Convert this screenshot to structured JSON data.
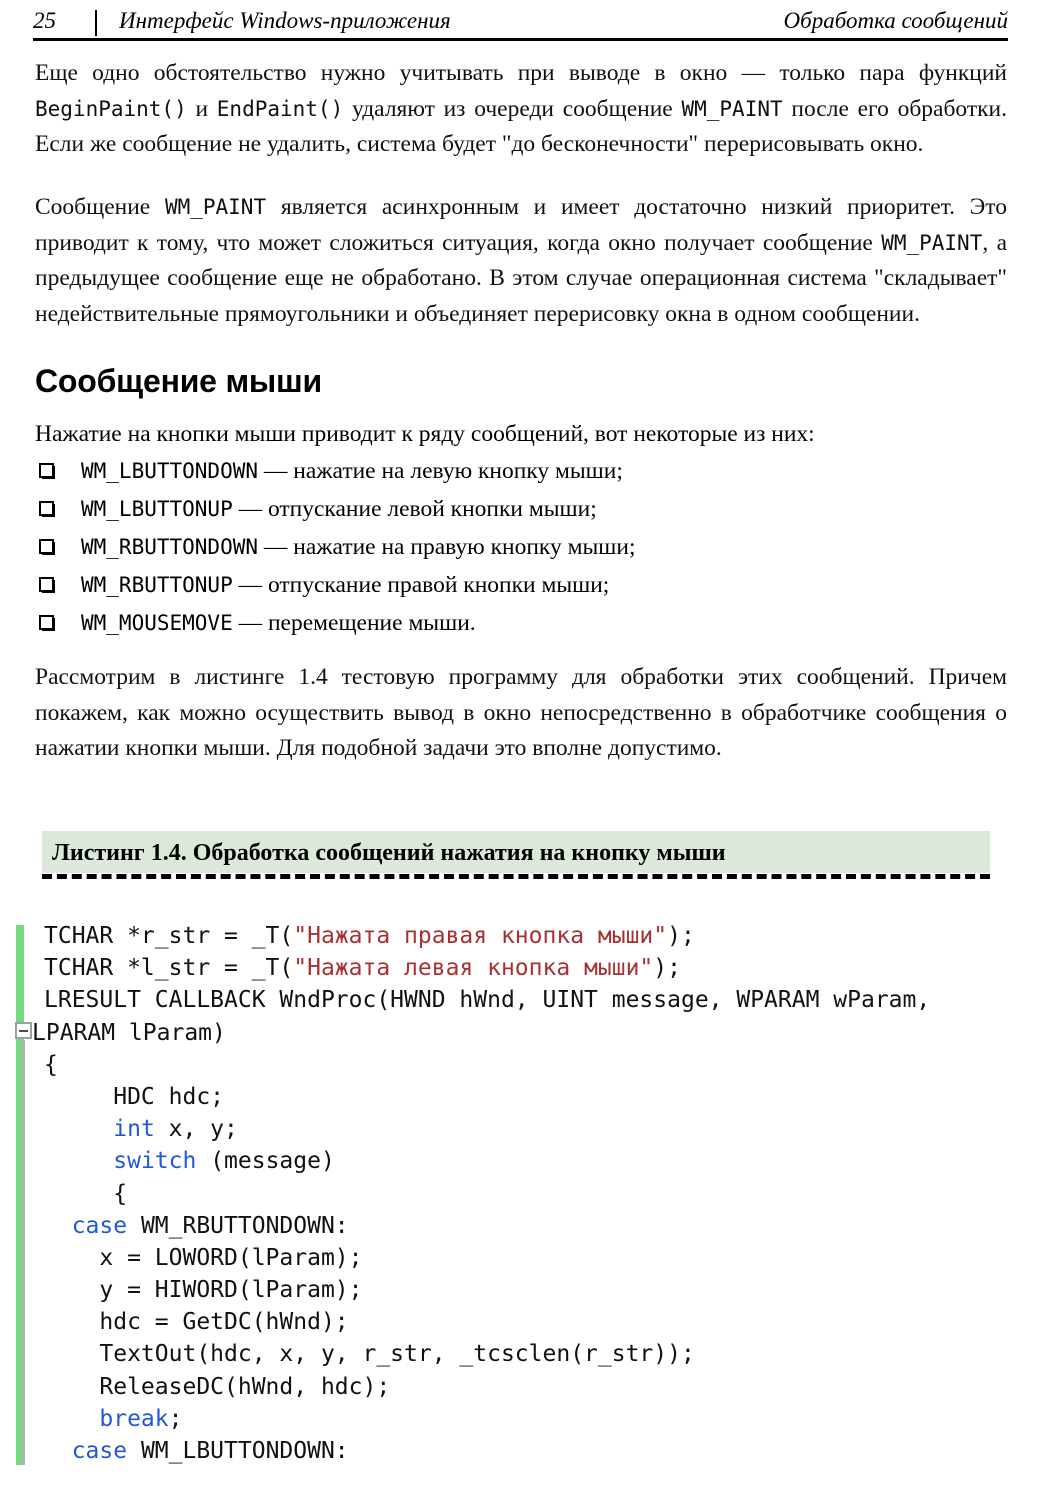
{
  "header": {
    "page_number": "25",
    "title_left": "Интерфейс Windows-приложения",
    "title_right": "Обработка сообщений"
  },
  "paragraphs": {
    "p1_a": "Еще одно обстоятельство нужно учитывать при выводе в окно — только пара функций ",
    "p1_code1": "BeginPaint()",
    "p1_b": " и ",
    "p1_code2": "EndPaint()",
    "p1_c": " удаляют из очереди сообщение ",
    "p1_code3": "WM_PAINT",
    "p1_d": " после его обработки. Если же сообщение не удалить, система будет \"до бесконечности\" перерисовывать окно.",
    "p2_a": "Сообщение ",
    "p2_code1": "WM_PAINT",
    "p2_b": " является асинхронным и имеет достаточно низкий приоритет. Это приводит к тому, что может сложиться ситуация, когда окно получает сообщение ",
    "p2_code2": "WM_PAINT",
    "p2_c": ", а предыдущее сообщение еще не обработано. В этом случае операционная система \"складывает\" недействительные прямоугольники и объединяет перерисовку окна в одном сообщении.",
    "p3": "Рассмотрим в листинге 1.4 тестовую программу для обработки этих сообщений. Причем покажем, как можно осуществить вывод в окно непосредственно в обработчике сообщения о нажатии кнопки мыши. Для подобной задачи это вполне допустимо."
  },
  "section": {
    "heading": "Сообщение мыши",
    "lead_in": "Нажатие на кнопки мыши приводит к ряду сообщений, вот некоторые из них:"
  },
  "message_list": [
    {
      "code": "WM_LBUTTONDOWN",
      "description": " — нажатие на левую кнопку мыши;"
    },
    {
      "code": "WM_LBUTTONUP",
      "description": " — отпускание левой кнопки мыши;"
    },
    {
      "code": "WM_RBUTTONDOWN",
      "description": " — нажатие на правую кнопку мыши;"
    },
    {
      "code": "WM_RBUTTONUP",
      "description": " — отпускание правой кнопки мыши;"
    },
    {
      "code": "WM_MOUSEMOVE",
      "description": " — перемещение мыши."
    }
  ],
  "listing": {
    "caption": "Листинг 1.4. Обработка сообщений нажатия на кнопку мыши",
    "band_color": "#dbe8da",
    "gutter_color": "#74da7f",
    "keyword_color": "#2457d6",
    "string_color": "#a83232",
    "collapse_marker": "−"
  },
  "code": {
    "lines": [
      {
        "segments": [
          {
            "t": "TCHAR *r_str = _T(",
            "c": "plain"
          },
          {
            "t": "\"Нажата правая кнопка мыши\"",
            "c": "str"
          },
          {
            "t": ");",
            "c": "plain"
          }
        ]
      },
      {
        "segments": [
          {
            "t": "TCHAR *l_str = _T(",
            "c": "plain"
          },
          {
            "t": "\"Нажата левая кнопка мыши\"",
            "c": "str"
          },
          {
            "t": ");",
            "c": "plain"
          }
        ]
      },
      {
        "segments": [
          {
            "t": "LRESULT CALLBACK WndProc(HWND hWnd, UINT message, WPARAM wParam,",
            "c": "plain"
          }
        ]
      },
      {
        "segments": [
          {
            "t": "LPARAM lParam)",
            "c": "plain"
          }
        ],
        "outdent": true
      },
      {
        "segments": [
          {
            "t": "{",
            "c": "plain"
          }
        ]
      },
      {
        "segments": [
          {
            "t": "     HDC hdc;",
            "c": "plain"
          }
        ]
      },
      {
        "segments": [
          {
            "t": "     ",
            "c": "plain"
          },
          {
            "t": "int",
            "c": "kw"
          },
          {
            "t": " x, y;",
            "c": "plain"
          }
        ]
      },
      {
        "segments": [
          {
            "t": "     ",
            "c": "plain"
          },
          {
            "t": "switch",
            "c": "kw"
          },
          {
            "t": " (message)",
            "c": "plain"
          }
        ]
      },
      {
        "segments": [
          {
            "t": "     {",
            "c": "plain"
          }
        ]
      },
      {
        "segments": [
          {
            "t": "  ",
            "c": "plain"
          },
          {
            "t": "case",
            "c": "kw"
          },
          {
            "t": " WM_RBUTTONDOWN:",
            "c": "plain"
          }
        ]
      },
      {
        "segments": [
          {
            "t": "    x = LOWORD(lParam);",
            "c": "plain"
          }
        ]
      },
      {
        "segments": [
          {
            "t": "    y = HIWORD(lParam);",
            "c": "plain"
          }
        ]
      },
      {
        "segments": [
          {
            "t": "    hdc = GetDC(hWnd);",
            "c": "plain"
          }
        ]
      },
      {
        "segments": [
          {
            "t": "    TextOut(hdc, x, y, r_str, _tcsclen(r_str));",
            "c": "plain"
          }
        ]
      },
      {
        "segments": [
          {
            "t": "    ReleaseDC(hWnd, hdc);",
            "c": "plain"
          }
        ]
      },
      {
        "segments": [
          {
            "t": "    ",
            "c": "plain"
          },
          {
            "t": "break",
            "c": "kw"
          },
          {
            "t": ";",
            "c": "plain"
          }
        ]
      },
      {
        "segments": [
          {
            "t": "  ",
            "c": "plain"
          },
          {
            "t": "case",
            "c": "kw"
          },
          {
            "t": " WM_LBUTTONDOWN:",
            "c": "plain"
          }
        ]
      }
    ]
  }
}
